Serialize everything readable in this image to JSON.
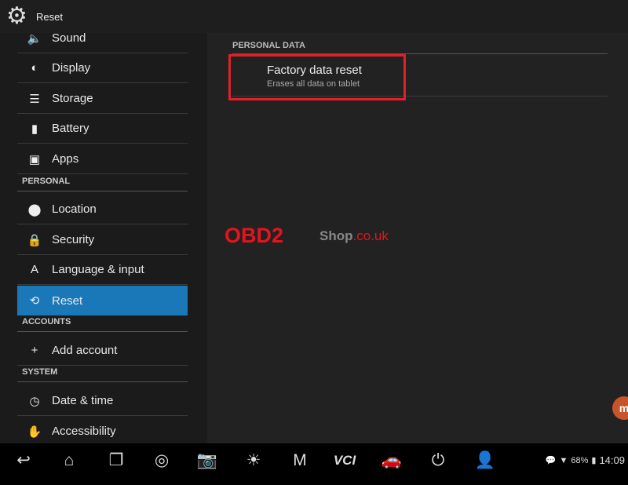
{
  "header": {
    "title": "Reset",
    "icon": "gear-icon"
  },
  "sidebar": {
    "items": [
      {
        "label": "Sound",
        "icon": "speaker-icon",
        "glyph": "🔈"
      },
      {
        "label": "Display",
        "icon": "brightness-icon",
        "glyph": "◐"
      },
      {
        "label": "Storage",
        "icon": "storage-icon",
        "glyph": "☰"
      },
      {
        "label": "Battery",
        "icon": "battery-icon",
        "glyph": "▮"
      },
      {
        "label": "Apps",
        "icon": "apps-icon",
        "glyph": "▣"
      },
      {
        "label": "Location",
        "icon": "location-icon",
        "glyph": "⬤"
      },
      {
        "label": "Security",
        "icon": "lock-icon",
        "glyph": "🔒"
      },
      {
        "label": "Language & input",
        "icon": "language-icon",
        "glyph": "A"
      },
      {
        "label": "Reset",
        "icon": "reset-icon",
        "glyph": "⟲",
        "selected": true
      },
      {
        "label": "Add account",
        "icon": "plus-icon",
        "glyph": "+"
      },
      {
        "label": "Date & time",
        "icon": "clock-icon",
        "glyph": "◷"
      },
      {
        "label": "Accessibility",
        "icon": "hand-icon",
        "glyph": "✋"
      }
    ],
    "headers": [
      "PERSONAL",
      "ACCOUNTS",
      "SYSTEM"
    ]
  },
  "main": {
    "section": "PERSONAL DATA",
    "factory_reset": {
      "title": "Factory data reset",
      "subtitle": "Erases all data on tablet"
    },
    "highlight_color": "#e0202a"
  },
  "watermark": {
    "part1": "OBD2",
    "part2": "Shop",
    "part3": ".co.uk"
  },
  "navbar": [
    {
      "icon": "back-icon",
      "glyph": "↩"
    },
    {
      "icon": "home-icon",
      "glyph": "⌂"
    },
    {
      "icon": "recent-apps-icon",
      "glyph": "❐"
    },
    {
      "icon": "chrome-icon",
      "glyph": "◎"
    },
    {
      "icon": "camera-icon",
      "glyph": "📷"
    },
    {
      "icon": "display-settings-icon",
      "glyph": "☀"
    },
    {
      "icon": "maxifix-icon",
      "glyph": "M"
    },
    {
      "icon": "vci-icon",
      "glyph": "VCI"
    },
    {
      "icon": "car-icon",
      "glyph": "🚗"
    },
    {
      "icon": "tpms-icon",
      "glyph": "⏻"
    },
    {
      "icon": "service-icon",
      "glyph": "👤"
    }
  ],
  "status": {
    "battery": "68%",
    "time": "14:09"
  },
  "colors": {
    "selected": "#1b78b8",
    "accent_red": "#e3141e"
  }
}
